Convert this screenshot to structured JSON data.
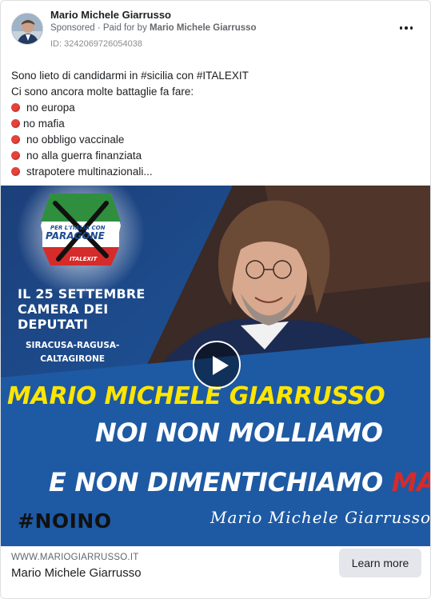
{
  "header": {
    "page_name": "Mario Michele Giarrusso",
    "sponsored": "Sponsored",
    "paid_for_prefix": " · Paid for by ",
    "payer": "Mario Michele Giarrusso",
    "ad_id": "ID: 3242069726054038"
  },
  "body": {
    "line1": "Sono lieto di candidarmi in #sicilia con #ITALEXIT",
    "line2": "Ci sono ancora molte battaglie fa fare:",
    "bullets": [
      "no europa",
      "no mafia",
      "no obbligo vaccinale",
      "no alla guerra finanziata",
      "strapotere multinazionali..."
    ]
  },
  "media": {
    "logo_line1": "PER L'ITALIA CON",
    "logo_line2": "PARAGONE",
    "logo_line3": "ITALEXIT",
    "date_line1": "IL 25 SETTEMBRE",
    "date_line2": "CAMERA DEI",
    "date_line3": "DEPUTATI",
    "loc_line1": "SIRACUSA-RAGUSA-",
    "loc_line2": "CALTAGIRONE",
    "headline": "MARIO MICHELE GIARRUSSO",
    "line_noi": "NOI NON MOLLIAMO",
    "line_dim": "E NON DIMENTICHIAMO ",
    "line_mai": "MAI",
    "hashtag": "#NOINO",
    "signature": "Mario Michele Giarrusso"
  },
  "footer": {
    "domain": "WWW.MARIOGIARRUSSO.IT",
    "title": "Mario Michele Giarrusso",
    "cta_label": "Learn more"
  },
  "colors": {
    "bullet_red": "#e8413b",
    "media_blue": "#1e5aa3",
    "headline_yellow": "#ffe500",
    "accent_red": "#d52b2b",
    "cta_bg": "#e4e6eb"
  },
  "icons": {
    "more": "more-options-icon",
    "play": "play-icon",
    "bullet": "red-circle-icon"
  }
}
